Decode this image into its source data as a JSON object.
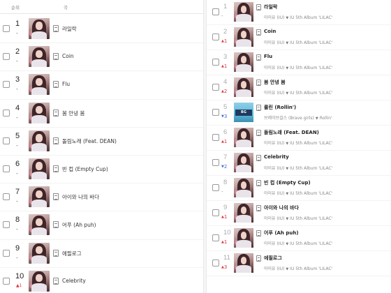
{
  "left": {
    "header": {
      "rank_label": "순위",
      "title_label": "곡"
    },
    "rows": [
      {
        "rank": "1",
        "change": "-",
        "change_dir": "same",
        "title": "라일락"
      },
      {
        "rank": "2",
        "change": "-",
        "change_dir": "same",
        "title": "Coin"
      },
      {
        "rank": "3",
        "change": "-",
        "change_dir": "same",
        "title": "Flu"
      },
      {
        "rank": "4",
        "change": "-",
        "change_dir": "same",
        "title": "봄 안녕 봄"
      },
      {
        "rank": "5",
        "change": "-",
        "change_dir": "same",
        "title": "돌림노래 (Feat. DEAN)"
      },
      {
        "rank": "6",
        "change": "-",
        "change_dir": "same",
        "title": "빈 컵 (Empty Cup)"
      },
      {
        "rank": "7",
        "change": "-",
        "change_dir": "same",
        "title": "아이와 나의 바다"
      },
      {
        "rank": "8",
        "change": "-",
        "change_dir": "same",
        "title": "어푸 (Ah puh)"
      },
      {
        "rank": "9",
        "change": "-",
        "change_dir": "same",
        "title": "에필로그"
      },
      {
        "rank": "10",
        "change": "1",
        "change_dir": "up",
        "title": "Celebrity"
      }
    ]
  },
  "right": {
    "rows": [
      {
        "rank": "1",
        "change": "-",
        "change_dir": "same",
        "title": "라일락",
        "artist": "아이유 (IU)",
        "album": "IU 5th Album 'LILAC'",
        "art": "iu"
      },
      {
        "rank": "2",
        "change": "1",
        "change_dir": "up",
        "title": "Coin",
        "artist": "아이유 (IU)",
        "album": "IU 5th Album 'LILAC'",
        "art": "iu"
      },
      {
        "rank": "3",
        "change": "1",
        "change_dir": "up",
        "title": "Flu",
        "artist": "아이유 (IU)",
        "album": "IU 5th Album 'LILAC'",
        "art": "iu"
      },
      {
        "rank": "4",
        "change": "2",
        "change_dir": "up",
        "title": "봄 안녕 봄",
        "artist": "아이유 (IU)",
        "album": "IU 5th Album 'LILAC'",
        "art": "iu"
      },
      {
        "rank": "5",
        "change": "3",
        "change_dir": "down",
        "title": "롤린 (Rollin')",
        "artist": "브레이브걸스 (Brave girls)",
        "album": "Rollin'",
        "art": "bg"
      },
      {
        "rank": "6",
        "change": "1",
        "change_dir": "up",
        "title": "돌림노래 (Feat. DEAN)",
        "artist": "아이유 (IU)",
        "album": "IU 5th Album 'LILAC'",
        "art": "iu"
      },
      {
        "rank": "7",
        "change": "2",
        "change_dir": "down",
        "title": "Celebrity",
        "artist": "아이유 (IU)",
        "album": "IU 5th Album 'LILAC'",
        "art": "iu"
      },
      {
        "rank": "8",
        "change": "-",
        "change_dir": "same",
        "title": "빈 컵 (Empty Cup)",
        "artist": "아이유 (IU)",
        "album": "IU 5th Album 'LILAC'",
        "art": "iu"
      },
      {
        "rank": "9",
        "change": "1",
        "change_dir": "up",
        "title": "아이와 나의 바다",
        "artist": "아이유 (IU)",
        "album": "IU 5th Album 'LILAC'",
        "art": "iu"
      },
      {
        "rank": "10",
        "change": "1",
        "change_dir": "up",
        "title": "어푸 (Ah puh)",
        "artist": "아이유 (IU)",
        "album": "IU 5th Album 'LILAC'",
        "art": "iu"
      },
      {
        "rank": "11",
        "change": "3",
        "change_dir": "up",
        "title": "에필로그",
        "artist": "아이유 (IU)",
        "album": "IU 5th Album 'LILAC'",
        "art": "iu"
      }
    ]
  },
  "colors": {
    "rank_up": "#e0333e",
    "rank_down": "#3d6fd6",
    "rank_same": "#888888"
  },
  "icons": {
    "up": "up-arrow-icon",
    "down": "down-arrow-icon",
    "lyrics": "document-icon",
    "more": "caret-down-icon"
  }
}
